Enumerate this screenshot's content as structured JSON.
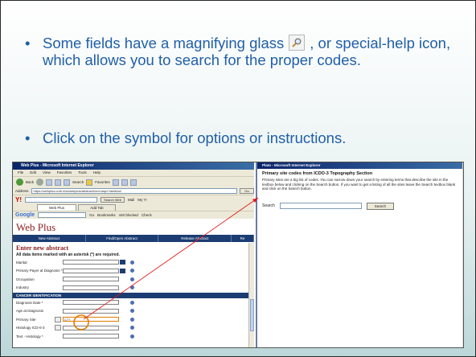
{
  "bullets": [
    {
      "text_before": "Some fields have a magnifying glass",
      "text_after": ", or special-help icon, which allows you to search for the proper codes."
    },
    {
      "text": "Click on the symbol for options or instructions."
    }
  ],
  "colors": {
    "bullet_text": "#1f5fa8",
    "nav_bar": "#1c3d73",
    "heading_red": "#8a1a1a",
    "arrow": "#e01818",
    "highlight_circle": "#e07a00"
  },
  "left_window": {
    "title": "Web Plus - Microsoft Internet Explorer",
    "menu": [
      "File",
      "Edit",
      "View",
      "Favorites",
      "Tools",
      "Help"
    ],
    "toolbar": {
      "back": "Back",
      "search": "Search",
      "favorites": "Favorites"
    },
    "address": {
      "label": "Address",
      "value": "https://webplus.umh.edu/webplus/abstract/cmd.aspx?abstract",
      "go": "Go"
    },
    "yahoo": {
      "logo": "Y!",
      "search_web": "Search Web",
      "mail": "Mail",
      "my": "My Y!"
    },
    "tabs": {
      "web_plus": "Web Plus",
      "add_tab": "Add Tab"
    },
    "google": {
      "logo": "Google",
      "go": "Go",
      "bookmarks": "Bookmarks",
      "blocked": "440 blocked",
      "check": "Check"
    },
    "app_title": "Web Plus",
    "nav": [
      "New Abstract",
      "Find/Open Abstract",
      "Release Abstract",
      "Re"
    ],
    "form_heading": "Enter new abstract",
    "required_note": "All data items marked with an asterisk (*) are required.",
    "fields": [
      {
        "label": "Marital",
        "value": "",
        "type": "dropdown"
      },
      {
        "label": "Primary Payer at Diagnosis *",
        "value": "",
        "type": "dropdown"
      },
      {
        "label": "Occupation",
        "value": "",
        "type": "text"
      },
      {
        "label": "Industry",
        "value": "",
        "type": "text"
      }
    ],
    "section_label": "CANCER IDENTIFICATION",
    "fields2": [
      {
        "label": "Diagnosis Date *",
        "value": "",
        "type": "text"
      },
      {
        "label": "Age at Diagnosis",
        "value": "",
        "type": "text"
      },
      {
        "label": "Primary Site",
        "value": "C??",
        "type": "lookup"
      },
      {
        "label": "Histology ICD-0-3",
        "value": "",
        "type": "lookup"
      },
      {
        "label": "Text - Histology *",
        "value": "",
        "type": "text"
      }
    ]
  },
  "right_window": {
    "title": "Plato - Microsoft Internet Explorer",
    "heading": "Primary site codes from ICDO-3 Topography Section",
    "description": "Primary sites are a big list of codes. You can narrow down your search by entering terms that describe the site in the textbox below and clicking on the Search button. If you want to get a listing of all the sites leave the Search textbox blank and click on the Search button.",
    "search_label": "Search",
    "search_value": "",
    "search_button": "Search"
  },
  "icons": {
    "magnifier": "magnifier-icon"
  }
}
